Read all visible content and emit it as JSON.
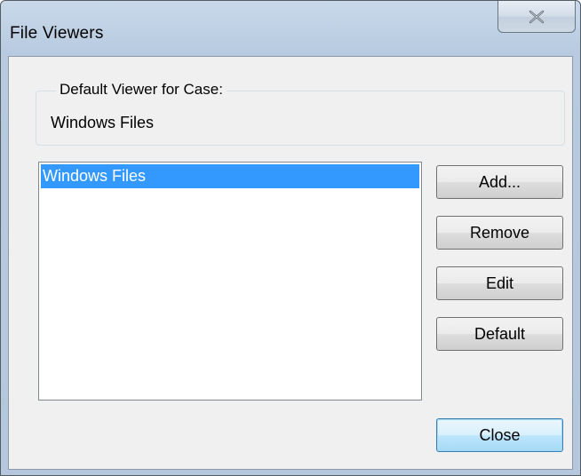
{
  "window": {
    "title": "File Viewers",
    "close_icon": "close-x-icon"
  },
  "group": {
    "legend": "Default Viewer for Case:",
    "value": "Windows Files"
  },
  "viewers_list": {
    "items": [
      {
        "label": "Windows Files",
        "selected": true
      }
    ]
  },
  "buttons": {
    "add": "Add...",
    "remove": "Remove",
    "edit": "Edit",
    "default": "Default",
    "close": "Close"
  },
  "colors": {
    "selection": "#3399ff",
    "accent_button_border": "#3c7fb1"
  }
}
